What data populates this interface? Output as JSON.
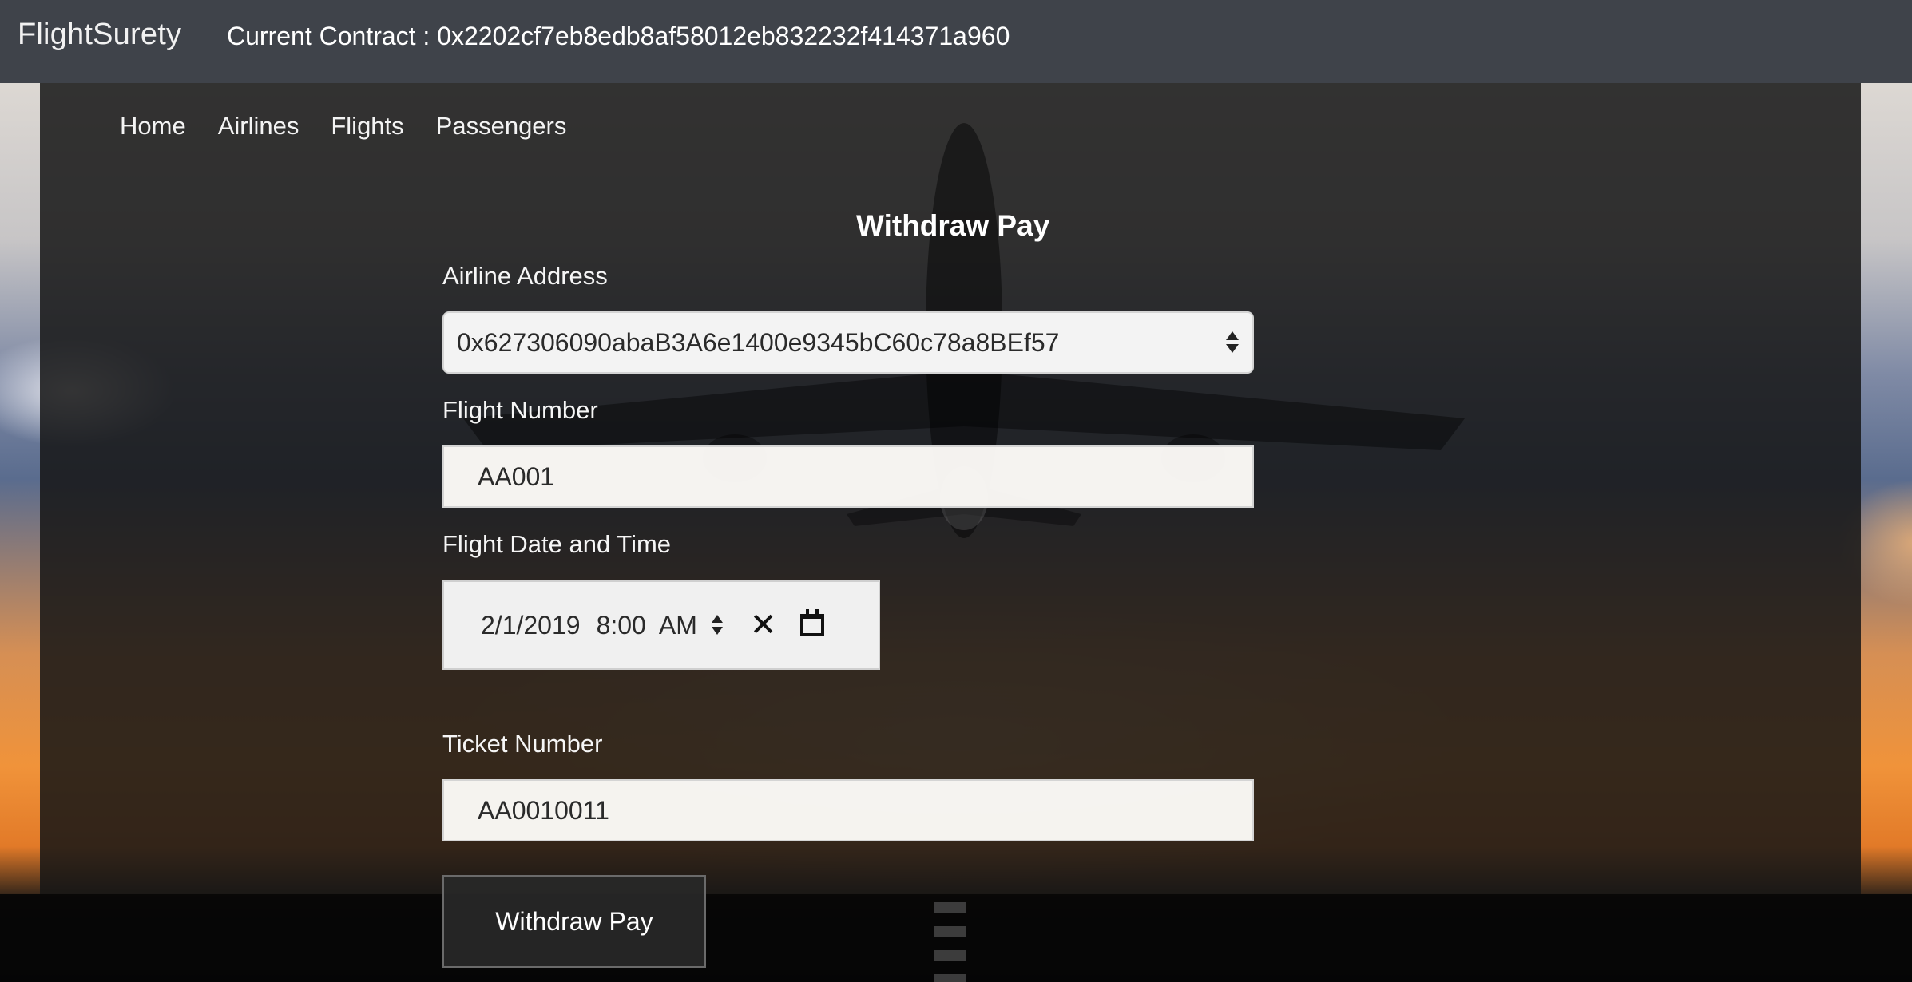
{
  "navbar": {
    "brand": "FlightSurety",
    "contract_text": "Current Contract : 0x2202cf7eb8edb8af58012eb832232f414371a960"
  },
  "nav": {
    "items": [
      "Home",
      "Airlines",
      "Flights",
      "Passengers"
    ]
  },
  "form": {
    "title": "Withdraw Pay",
    "airline_label": "Airline Address",
    "airline_value": "0x627306090abaB3A6e1400e9345bC60c78a8BEf57",
    "flight_number_label": "Flight Number",
    "flight_number_value": "AA001",
    "datetime_label": "Flight Date and Time",
    "date_value": "2/1/2019",
    "time_value": "8:00",
    "ampm_value": "AM",
    "ticket_label": "Ticket Number",
    "ticket_value": "AA0010011",
    "submit_label": "Withdraw Pay"
  },
  "icons": {
    "select_arrows": "updown-arrows-icon",
    "clear": "close-icon",
    "calendar": "calendar-icon"
  }
}
